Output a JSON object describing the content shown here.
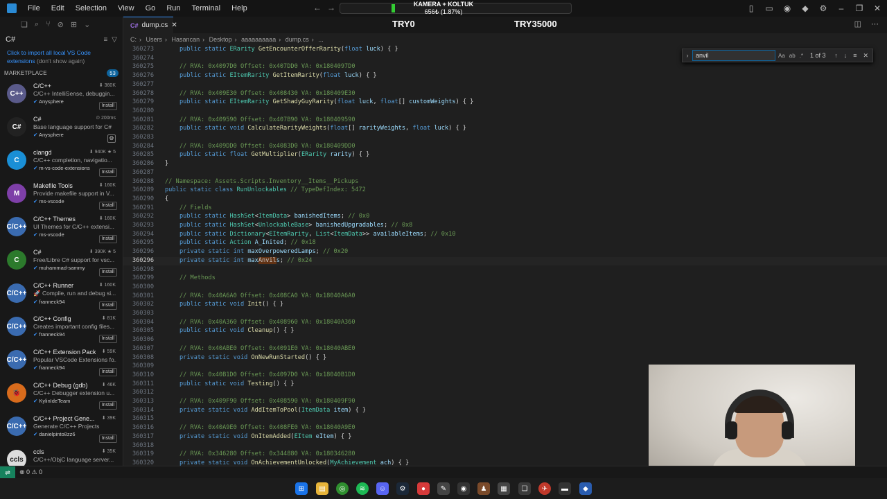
{
  "menu": [
    "File",
    "Edit",
    "Selection",
    "View",
    "Go",
    "Run",
    "Terminal",
    "Help"
  ],
  "overlay": {
    "camera_label": "KAMERA + KOLTUK",
    "camera_amount": "656₺ (1.87%)",
    "try_a": "TRY0",
    "try_b": "TRY35000"
  },
  "sidebar": {
    "search_query": "C#",
    "hint_link": "Click to import all local VS Code extensions",
    "hint_dim": "(don't show again)",
    "marketplace_label": "MARKETPLACE",
    "marketplace_count": "53",
    "extensions": [
      {
        "logo": "C++",
        "logo_color": "#5a5a8a",
        "name": "C/C++",
        "desc": "C/C++ IntelliSense, debuggin...",
        "publisher": "Anysphere",
        "stats": "⬇ 360K",
        "action": "Install"
      },
      {
        "logo": "C#",
        "logo_color": "#222222",
        "name": "C#",
        "desc": "Base language support for C#",
        "publisher": "Anysphere",
        "stats": "⏲ 200ms",
        "action": "⚙"
      },
      {
        "logo": "C",
        "logo_color": "#1a8fd6",
        "name": "clangd",
        "desc": "C/C++ completion, navigatio...",
        "publisher": "m-vs-code-extensions",
        "stats": "⬇ 940K ★ 5",
        "action": "Install"
      },
      {
        "logo": "M",
        "logo_color": "#7e3fa8",
        "name": "Makefile Tools",
        "desc": "Provide makefile support in V...",
        "publisher": "ms-vscode",
        "stats": "⬇ 160K",
        "action": "Install"
      },
      {
        "logo": "C/C++",
        "logo_color": "#3a6bb0",
        "name": "C/C++ Themes",
        "desc": "UI Themes for C/C++ extensi...",
        "publisher": "ms-vscode",
        "stats": "⬇ 160K",
        "action": "Install"
      },
      {
        "logo": "C",
        "logo_color": "#2c7a2c",
        "name": "C#",
        "desc": "Free/Libre C# support for vsc...",
        "publisher": "muhammad-sammy",
        "stats": "⬇ 390K ★ 5",
        "action": "Install"
      },
      {
        "logo": "C/C++",
        "logo_color": "#3a6bb0",
        "name": "C/C++ Runner",
        "desc": "🚀 Compile, run and debug si...",
        "publisher": "franneck94",
        "stats": "⬇ 160K",
        "action": "Install"
      },
      {
        "logo": "C/C++",
        "logo_color": "#3a6bb0",
        "name": "C/C++ Config",
        "desc": "Creates important config files...",
        "publisher": "franneck94",
        "stats": "⬇ 81K",
        "action": "Install"
      },
      {
        "logo": "C/C++",
        "logo_color": "#3a6bb0",
        "name": "C/C++ Extension Pack",
        "desc": "Popular VSCode Extensions fo...",
        "publisher": "franneck94",
        "stats": "⬇ 59K",
        "action": "Install"
      },
      {
        "logo": "🐞",
        "logo_color": "#d86b1c",
        "name": "C/C++ Debug (gdb)",
        "desc": "C/C++ Debugger extension u...",
        "publisher": "KylinIdeTeam",
        "stats": "⬇ 46K",
        "action": "Install"
      },
      {
        "logo": "C/C++",
        "logo_color": "#3a6bb0",
        "name": "C/C++ Project Gene...",
        "desc": "Generate C/C++ Projects",
        "publisher": "danielpinto8zz6",
        "stats": "⬇ 39K",
        "action": "Install"
      },
      {
        "logo": "ccls",
        "logo_color": "#dddddd",
        "name": "ccls",
        "desc": "C/C++/ObjC language server...",
        "publisher": "",
        "stats": "⬇ 35K",
        "action": ""
      }
    ]
  },
  "tab": {
    "label": "dump.cs",
    "icon": "C#"
  },
  "breadcrumb": [
    "C:",
    "Users",
    "Hasancan",
    "Desktop",
    "aaaaaaaaaa",
    "dump.cs",
    "..."
  ],
  "find": {
    "query": "anvil",
    "count": "1 of 3"
  },
  "status": {
    "problems": "⊗ 0  ⚠ 0"
  }
}
